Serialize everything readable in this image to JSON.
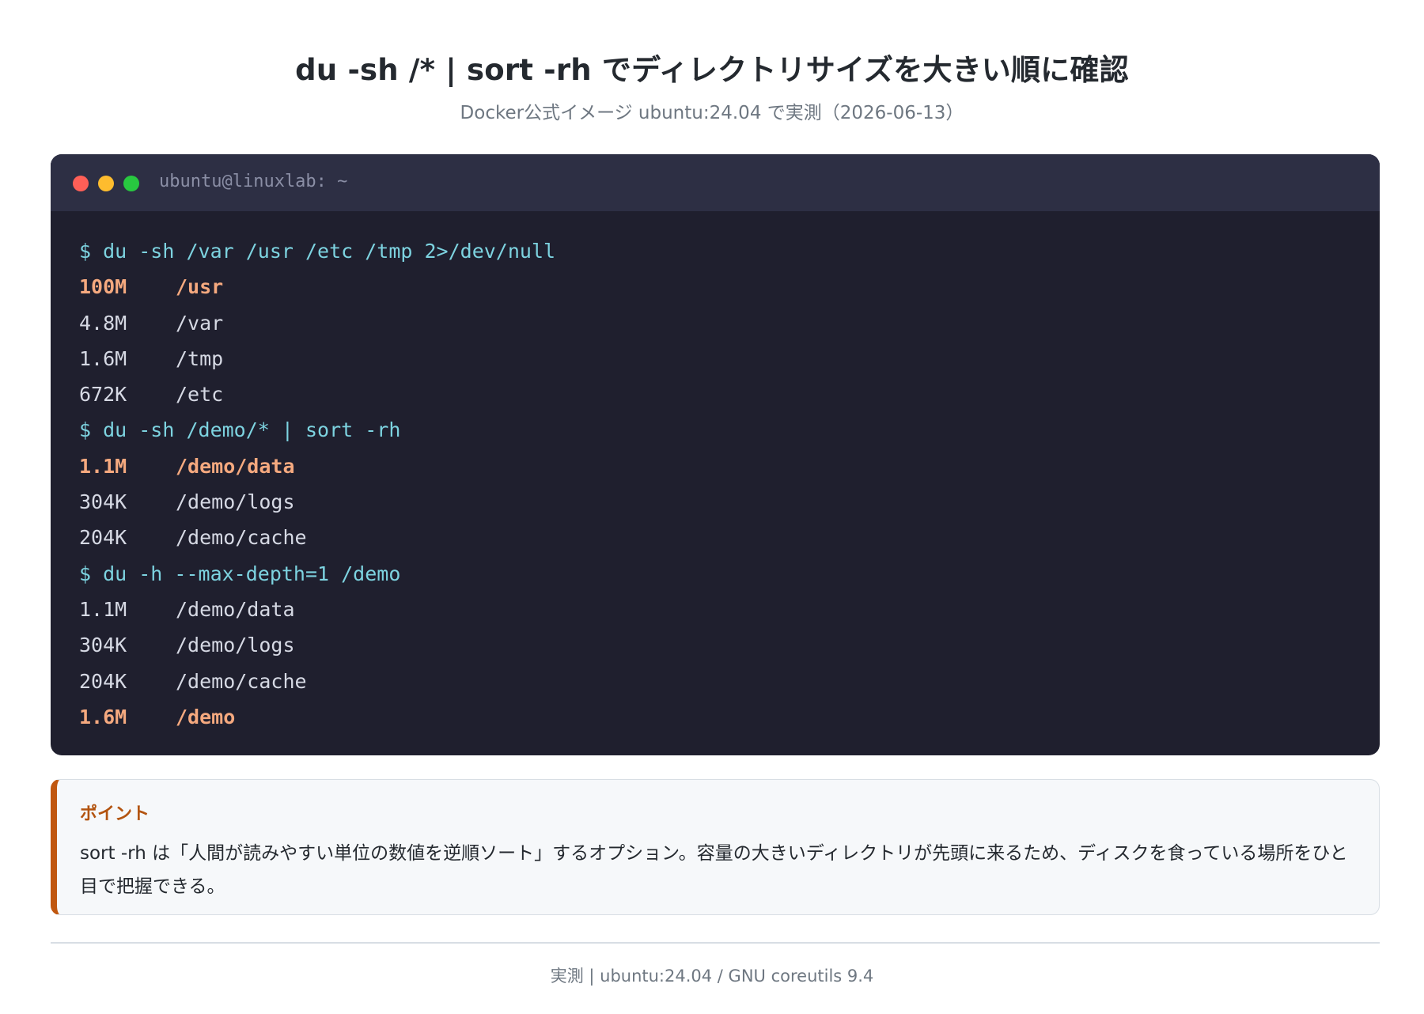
{
  "header": {
    "title": "du -sh /* | sort -rh でディレクトリサイズを大きい順に確認",
    "subtitle": "Docker公式イメージ ubuntu:24.04 で実測（2026-06-13）"
  },
  "terminal": {
    "title": "ubuntu@linuxlab: ~",
    "window_buttons": [
      "close",
      "minimize",
      "maximize"
    ],
    "colors": {
      "background": "#1f1f2e",
      "header": "#2d2f44",
      "command": "#7dd3e0",
      "output": "#d6d9e4",
      "highlight": "#f5a97f"
    },
    "lines": [
      {
        "type": "cmd",
        "text": "$ du -sh /var /usr /etc /tmp 2>/dev/null"
      },
      {
        "type": "hl",
        "size": "100M",
        "path": "/usr"
      },
      {
        "type": "out",
        "size": "4.8M",
        "path": "/var"
      },
      {
        "type": "out",
        "size": "1.6M",
        "path": "/tmp"
      },
      {
        "type": "out",
        "size": "672K",
        "path": "/etc"
      },
      {
        "type": "cmd",
        "text": "$ du -sh /demo/* | sort -rh"
      },
      {
        "type": "hl",
        "size": "1.1M",
        "path": "/demo/data"
      },
      {
        "type": "out",
        "size": "304K",
        "path": "/demo/logs"
      },
      {
        "type": "out",
        "size": "204K",
        "path": "/demo/cache"
      },
      {
        "type": "cmd",
        "text": "$ du -h --max-depth=1 /demo"
      },
      {
        "type": "out",
        "size": "1.1M",
        "path": "/demo/data"
      },
      {
        "type": "out",
        "size": "304K",
        "path": "/demo/logs"
      },
      {
        "type": "out",
        "size": "204K",
        "path": "/demo/cache"
      },
      {
        "type": "hl",
        "size": "1.6M",
        "path": "/demo"
      }
    ]
  },
  "callout": {
    "title": "ポイント",
    "body": "sort -rh は「人間が読みやすい単位の数値を逆順ソート」するオプション。容量の大きいディレクトリが先頭に来るため、ディスクを食っている場所をひと目で把握できる。",
    "accent": "#c0570f"
  },
  "footer": {
    "text": "実測 | ubuntu:24.04 / GNU coreutils 9.4"
  }
}
